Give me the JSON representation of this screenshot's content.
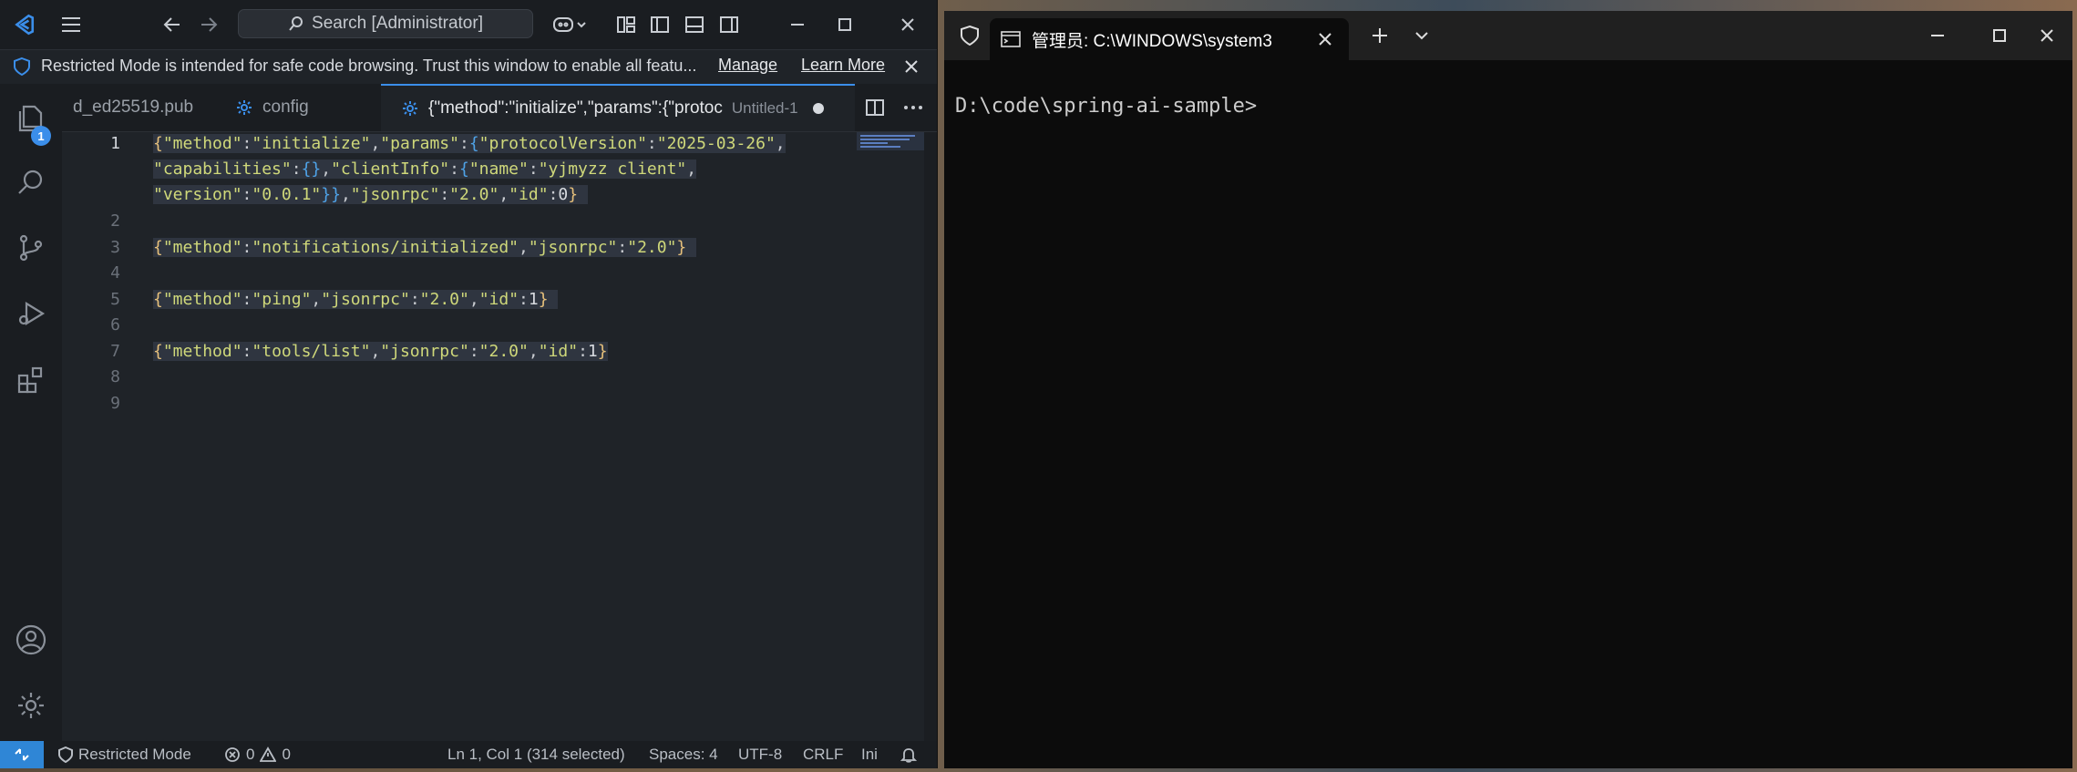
{
  "vscode": {
    "search_placeholder": "Search [Administrator]",
    "banner": {
      "message": "Restricted Mode is intended for safe code browsing. Trust this window to enable all featu...",
      "manage": "Manage",
      "learn_more": "Learn More"
    },
    "explorer_badge": "1",
    "tabs": [
      {
        "label": "d_ed25519.pub"
      },
      {
        "label": "config"
      },
      {
        "label": "{\"method\":\"initialize\",\"params\":{\"protoc",
        "sub": "Untitled-1"
      }
    ],
    "line_numbers": [
      "1",
      "2",
      "3",
      "4",
      "5",
      "6",
      "7",
      "8",
      "9"
    ],
    "status": {
      "restricted": "Restricted Mode",
      "errors": "0",
      "warnings": "0",
      "position": "Ln 1, Col 1 (314 selected)",
      "spaces": "Spaces: 4",
      "encoding": "UTF-8",
      "eol": "CRLF",
      "language": "Ini"
    }
  },
  "code": {
    "l1a": "\"method\"",
    "l1b": "\"initialize\"",
    "l1c": "\"params\"",
    "l1d": "\"protocolVersion\"",
    "l1e": "\"2025-03-26\"",
    "l1f": "\"capabilities\"",
    "l1g": "\"clientInfo\"",
    "l1h": "\"name\"",
    "l1i": "\"yjmyzz client\"",
    "l1j": "\"version\"",
    "l1k": "\"0.0.1\"",
    "l1l": "\"jsonrpc\"",
    "l1m": "\"2.0\"",
    "l1n": "\"id\"",
    "l1o": "0",
    "l3a": "\"method\"",
    "l3b": "\"notifications/initialized\"",
    "l3c": "\"jsonrpc\"",
    "l3d": "\"2.0\"",
    "l5a": "\"method\"",
    "l5b": "\"ping\"",
    "l5c": "\"jsonrpc\"",
    "l5d": "\"2.0\"",
    "l5e": "\"id\"",
    "l5f": "1",
    "l7a": "\"method\"",
    "l7b": "\"tools/list\"",
    "l7c": "\"jsonrpc\"",
    "l7d": "\"2.0\"",
    "l7e": "\"id\"",
    "l7f": "1"
  },
  "terminal": {
    "tab_title": "管理员: C:\\WINDOWS\\system3",
    "prompt": "D:\\code\\spring-ai-sample>"
  },
  "colors": {
    "accent": "#3b8eea",
    "remote": "#2f86d6",
    "string": "#cfd87a",
    "brace": "#e6c07b"
  }
}
